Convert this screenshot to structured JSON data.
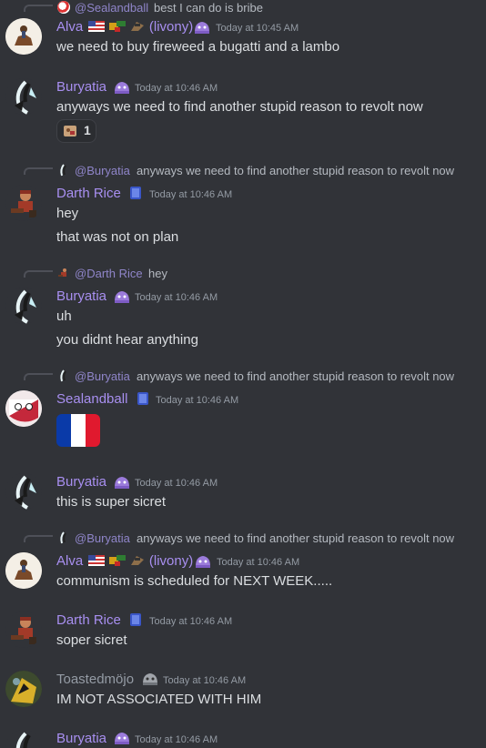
{
  "channel": {
    "top_reply": {
      "author": "@Sealandball",
      "text": "best I can do is bribe"
    },
    "messages": [
      {
        "author": "Alva",
        "badges_suffix": "(livony)",
        "time": "Today at 10:45 AM",
        "lines": [
          "we need to buy fireweed a bugatti and a lambo"
        ]
      },
      {
        "author": "Buryatia",
        "time": "Today at 10:46 AM",
        "lines": [
          "anyways we need to find another stupid reason to revolt now"
        ],
        "reaction_count": "1"
      },
      {
        "reply": {
          "author": "@Buryatia",
          "text": "anyways we need to find another stupid reason to revolt now"
        },
        "author": "Darth Rice",
        "time": "Today at 10:46 AM",
        "lines": [
          "hey",
          "that was not on plan"
        ]
      },
      {
        "reply": {
          "author": "@Darth Rice",
          "text": "hey"
        },
        "author": "Buryatia",
        "time": "Today at 10:46 AM",
        "lines": [
          "uh",
          "you didnt hear anything"
        ]
      },
      {
        "reply": {
          "author": "@Buryatia",
          "text": "anyways we need to find another stupid reason to revolt now"
        },
        "author": "Sealandball",
        "time": "Today at 10:46 AM",
        "lines": []
      },
      {
        "author": "Buryatia",
        "time": "Today at 10:46 AM",
        "lines": [
          "this is super sicret"
        ]
      },
      {
        "reply": {
          "author": "@Buryatia",
          "text": "anyways we need to find another stupid reason to revolt now"
        },
        "author": "Alva",
        "badges_suffix": "(livony)",
        "time": "Today at 10:46 AM",
        "lines": [
          "communism is scheduled for NEXT WEEK....."
        ]
      },
      {
        "author": "Darth Rice",
        "time": "Today at 10:46 AM",
        "lines": [
          "soper sicret"
        ]
      },
      {
        "author": "Toastedmöjo",
        "time": "Today at 10:46 AM",
        "lines": [
          "IM NOT ASSOCIATED WITH HIM"
        ]
      },
      {
        "author": "Buryatia",
        "time": "Today at 10:46 AM",
        "lines": []
      }
    ]
  },
  "colors": {
    "background": "#313338",
    "username": "#a88ff0",
    "muted": "#949ba4",
    "text": "#dbdee1",
    "reply_name": "#8f85c9"
  }
}
